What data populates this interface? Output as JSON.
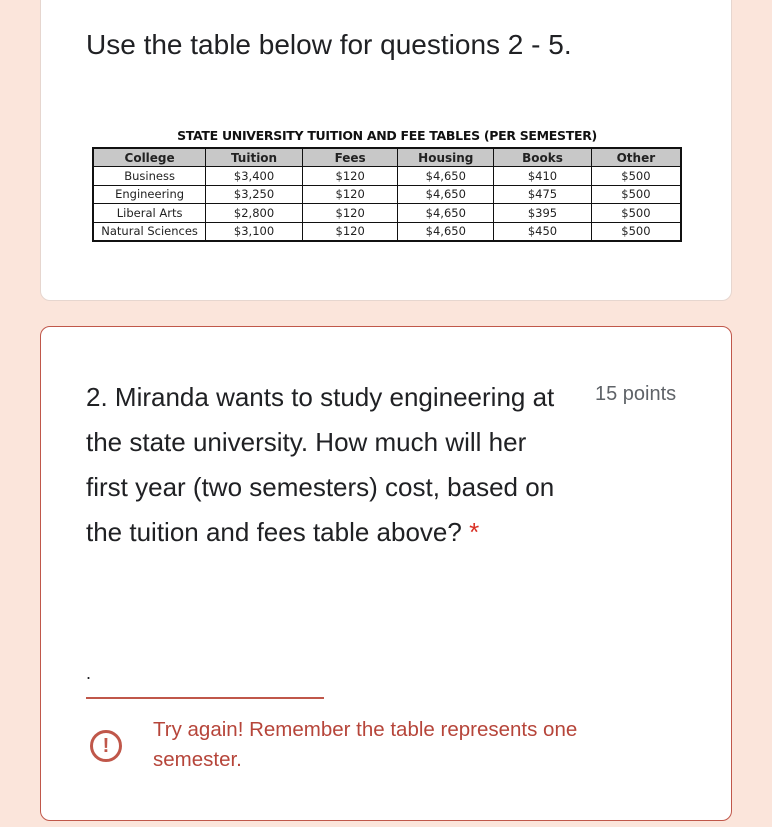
{
  "intro": "Use the table below for questions 2 - 5.",
  "table": {
    "title": "STATE UNIVERSITY TUITION AND FEE TABLES (PER SEMESTER)",
    "headers": [
      "College",
      "Tuition",
      "Fees",
      "Housing",
      "Books",
      "Other"
    ],
    "rows": [
      [
        "Business",
        "$3,400",
        "$120",
        "$4,650",
        "$410",
        "$500"
      ],
      [
        "Engineering",
        "$3,250",
        "$120",
        "$4,650",
        "$475",
        "$500"
      ],
      [
        "Liberal Arts",
        "$2,800",
        "$120",
        "$4,650",
        "$395",
        "$500"
      ],
      [
        "Natural Sciences",
        "$3,100",
        "$120",
        "$4,650",
        "$450",
        "$500"
      ]
    ]
  },
  "question": {
    "text": "2. Miranda wants to study engineering at the state university. How much will her first year (two semesters) cost, based on the tuition and fees table above?",
    "required_mark": "*",
    "points": "15 points",
    "answer_value": ".",
    "error_icon": "exclamation-circle-icon",
    "error_text": "Try again! Remember the table represents one semester."
  },
  "colors": {
    "background": "#fbe5db",
    "error": "#c0574a"
  }
}
